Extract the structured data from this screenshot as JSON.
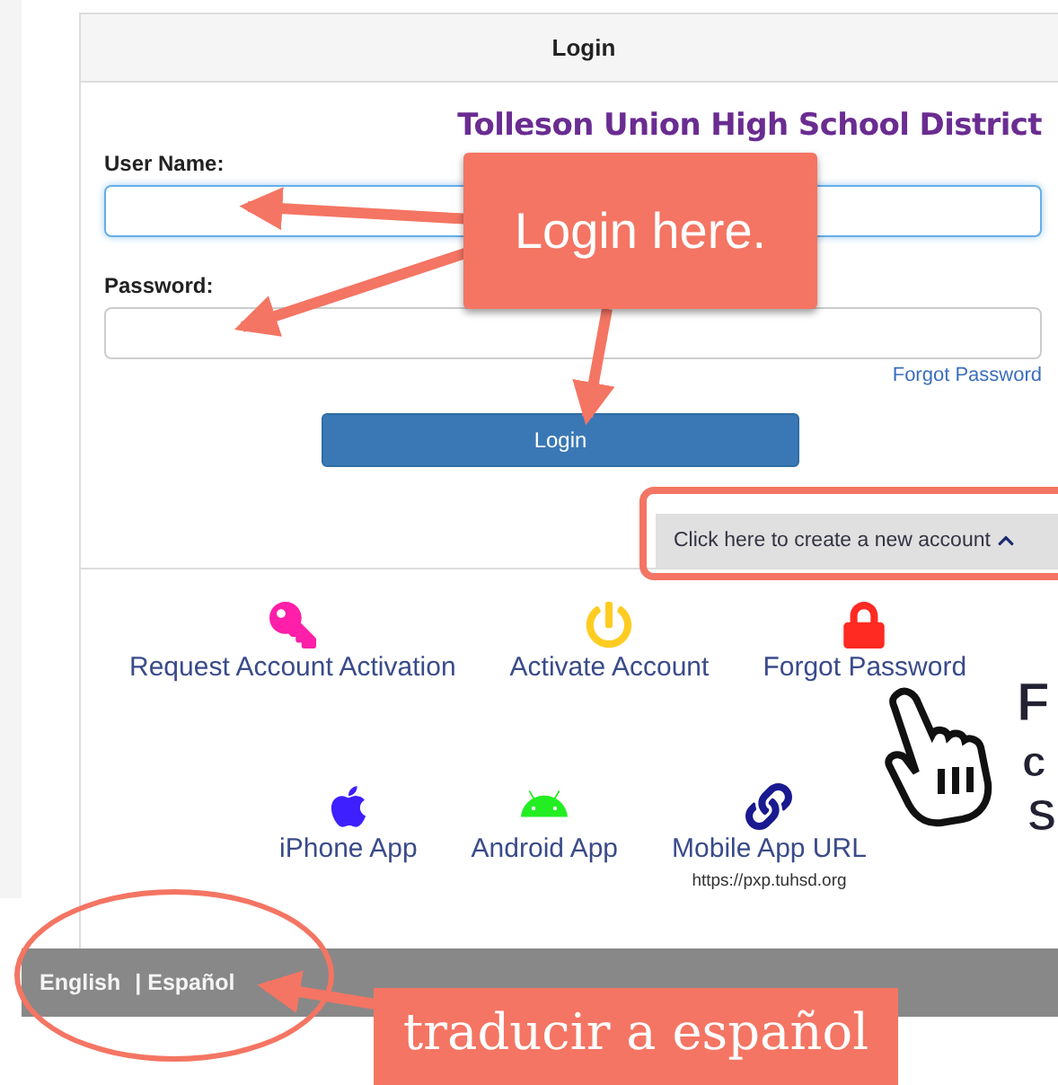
{
  "panel": {
    "title": "Login",
    "district": "Tolleson Union High School District",
    "fields": [
      {
        "label": "User Name:",
        "focused": true
      },
      {
        "label": "Password:",
        "focused": false
      }
    ],
    "forgot_link": "Forgot Password",
    "login_button": "Login",
    "create_account": "Click here to create a new account"
  },
  "actions": [
    {
      "label": "Request Account Activation",
      "kind": "key",
      "color": "#ff1fa8"
    },
    {
      "label": "Activate Account",
      "kind": "power",
      "color": "#ffcc22"
    },
    {
      "label": "Forgot Password",
      "kind": "lock",
      "color": "#ff2a22"
    }
  ],
  "apps": [
    {
      "label": "iPhone App",
      "kind": "apple",
      "color": "#3d1fff"
    },
    {
      "label": "Android App",
      "kind": "android",
      "color": "#22ee22"
    },
    {
      "label": "Mobile App URL",
      "kind": "link",
      "color": "#1a1a90",
      "sub": "https://pxp.tuhsd.org"
    }
  ],
  "footer": {
    "languages": [
      "English",
      "| Español"
    ]
  },
  "annotations": {
    "login_callout": "Login here.",
    "language_callout": "traducir a español",
    "cut_callout_lines": [
      "F",
      "c",
      "S"
    ]
  }
}
